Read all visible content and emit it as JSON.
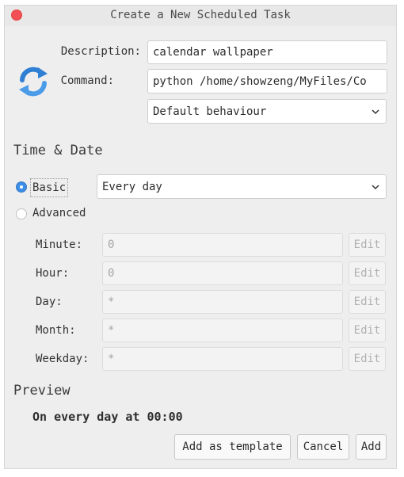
{
  "window": {
    "title": "Create a New Scheduled Task"
  },
  "form": {
    "description_label": "Description:",
    "description_value": "calendar wallpaper",
    "command_label": "Command:",
    "command_value": "python /home/showzeng/MyFiles/Co",
    "behaviour_selected": "Default behaviour",
    "icon": "refresh-arrows-icon"
  },
  "time_date": {
    "heading": "Time & Date",
    "basic_label": "Basic",
    "basic_selected": "Every day",
    "advanced_label": "Advanced",
    "mode": "basic",
    "rows": [
      {
        "label": "Minute:",
        "value": "0",
        "edit": "Edit"
      },
      {
        "label": "Hour:",
        "value": "0",
        "edit": "Edit"
      },
      {
        "label": "Day:",
        "value": "*",
        "edit": "Edit"
      },
      {
        "label": "Month:",
        "value": "*",
        "edit": "Edit"
      },
      {
        "label": "Weekday:",
        "value": "*",
        "edit": "Edit"
      }
    ]
  },
  "preview": {
    "heading": "Preview",
    "text": "On every day at 00:00"
  },
  "buttons": {
    "template": "Add as template",
    "cancel": "Cancel",
    "add": "Add"
  },
  "colors": {
    "close": "#f25056",
    "radio_accent": "#3d8ee6",
    "icon_blue": "#2f7fd4"
  }
}
